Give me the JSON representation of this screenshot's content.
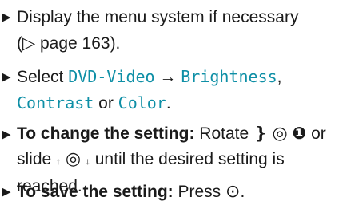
{
  "steps": [
    {
      "text": "Display the menu system if necessary",
      "page_ref": "(▷ page 163)."
    },
    {
      "prefix": "Select ",
      "menu_dvd": "DVD-Video",
      "menu_arrow": " → ",
      "menu_brightness": "Brightness",
      "comma": ",",
      "menu_contrast": "Contrast",
      "or": " or ",
      "menu_color": "Color",
      "period": "."
    },
    {
      "bold": "To change the setting:",
      "rotate": " Rotate ",
      "or": " or",
      "slide": "slide ",
      "until": " until the desired setting is",
      "reached": "reached."
    },
    {
      "bold": "To save the setting:",
      "press": " Press ",
      "period": "."
    }
  ],
  "icons": {
    "bullet": "▶",
    "left_bracket": "❵",
    "right_bracket": "❶",
    "controller": "◎",
    "up": "↑",
    "down": "↓",
    "press": "⊙"
  }
}
